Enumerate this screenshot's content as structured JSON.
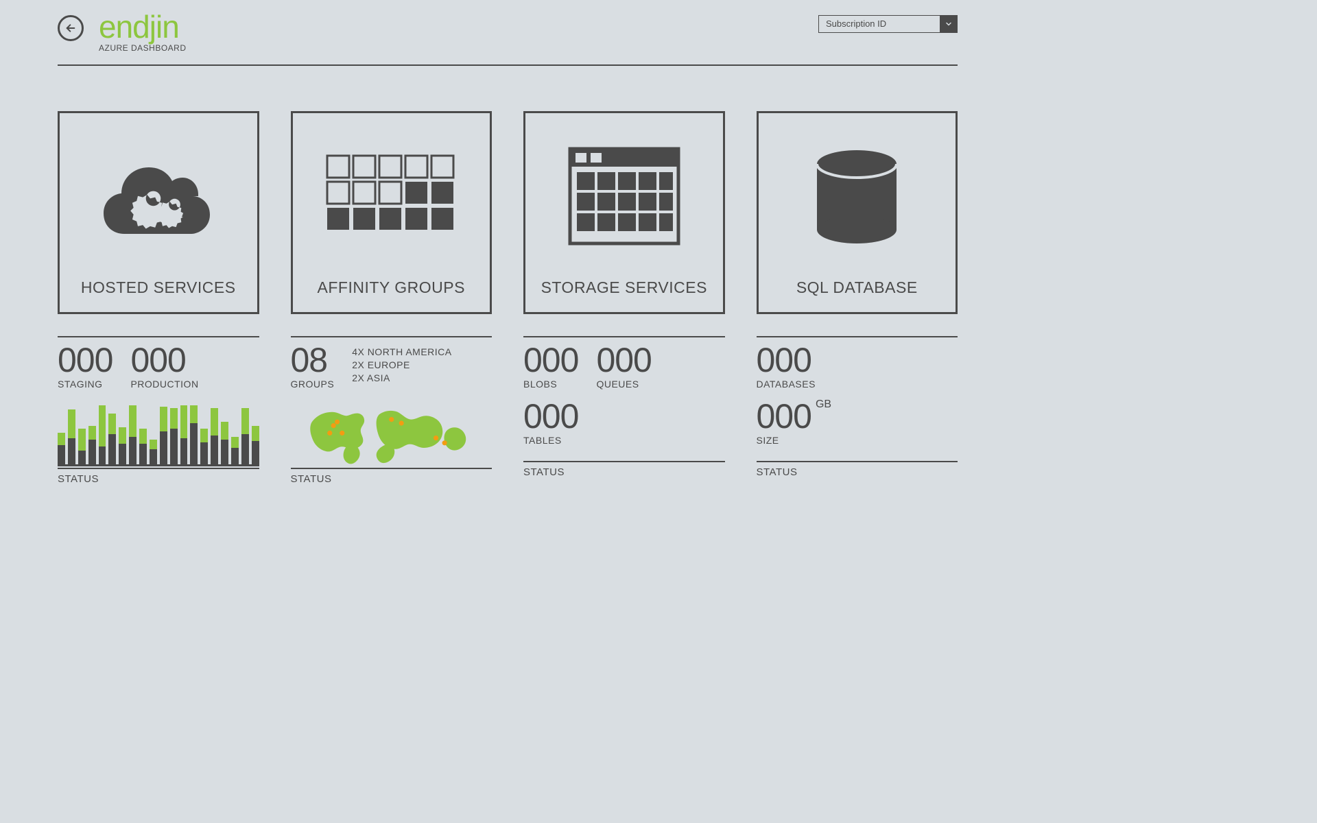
{
  "header": {
    "brand_name": "endjin",
    "brand_subtitle": "AZURE DASHBOARD",
    "subscription_select_label": "Subscription ID"
  },
  "tiles": {
    "hosted_services": {
      "title": "HOSTED SERVICES"
    },
    "affinity_groups": {
      "title": "AFFINITY GROUPS"
    },
    "storage_services": {
      "title": "STORAGE SERVICES"
    },
    "sql_database": {
      "title": "SQL DATABASE"
    }
  },
  "hosted_services": {
    "staging": {
      "value": "000",
      "label": "STAGING"
    },
    "production": {
      "value": "000",
      "label": "PRODUCTION"
    },
    "status_label": "STATUS",
    "bars": {
      "green": [
        18,
        42,
        32,
        20,
        60,
        30,
        24,
        46,
        22,
        14,
        36,
        30,
        48,
        26,
        20,
        40,
        26,
        16,
        38,
        22
      ],
      "dark": [
        28,
        38,
        20,
        36,
        26,
        44,
        30,
        40,
        30,
        22,
        48,
        52,
        38,
        60,
        32,
        42,
        36,
        24,
        44,
        34
      ]
    }
  },
  "affinity_groups": {
    "groups_value": "08",
    "groups_label": "GROUPS",
    "regions": [
      "4X NORTH AMERICA",
      "2X EUROPE",
      "2X ASIA"
    ],
    "status_label": "STATUS"
  },
  "storage_services": {
    "blobs": {
      "value": "000",
      "label": "BLOBS"
    },
    "queues": {
      "value": "000",
      "label": "QUEUES"
    },
    "tables": {
      "value": "000",
      "label": "TABLES"
    },
    "status_label": "STATUS"
  },
  "sql_database": {
    "databases": {
      "value": "000",
      "label": "DATABASES"
    },
    "size": {
      "value": "000",
      "unit": "GB",
      "label": "SIZE"
    },
    "status_label": "STATUS"
  }
}
